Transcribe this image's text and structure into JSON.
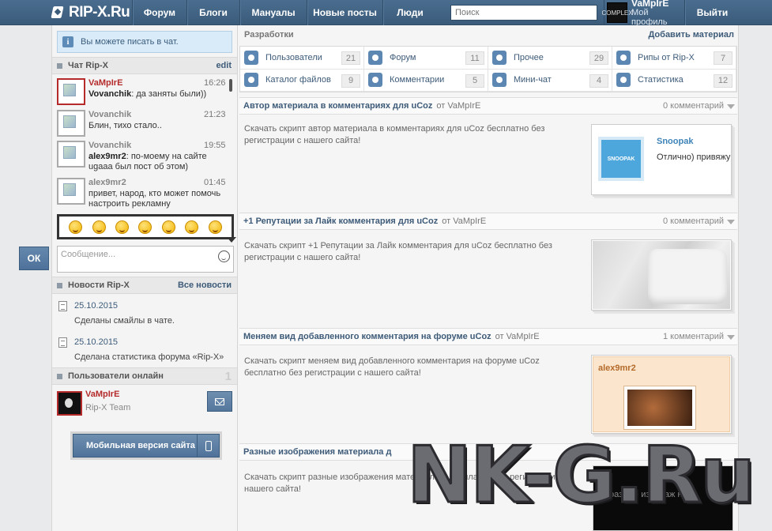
{
  "header": {
    "logo": "RIP-X.Ru",
    "nav": [
      "Форум",
      "Блоги",
      "Мануалы",
      "Новые посты",
      "Люди"
    ],
    "search_placeholder": "Поиск",
    "profile_name": "VaMpIrE",
    "profile_sub": "Мой профиль",
    "logout": "Выйти",
    "avatar_text": "COMPLEX"
  },
  "sidebar": {
    "notice": "Вы можете писать в чат.",
    "chat_title": "Чат Rip-X",
    "chat_edit": "edit",
    "chat": [
      {
        "name": "VaMpIrE",
        "time": "16:26",
        "author": "Vovanchik",
        "text": ": да заняты были))",
        "red": true
      },
      {
        "name": "Vovanchik",
        "time": "21:23",
        "author": "",
        "text": "Блин, тихо стало..",
        "red": false
      },
      {
        "name": "Vovanchik",
        "time": "19:55",
        "author": "alex9mr2",
        "text": ": по-моему на сайте ugaaa был пост об этом)",
        "red": false
      },
      {
        "name": "alex9mr2",
        "time": "01:45",
        "author": "",
        "text": "привет, народ, кто может помочь настроить рекламну",
        "red": false
      }
    ],
    "smiles": [
      "smile-1",
      "smile-2",
      "smile-3",
      "smile-4",
      "smile-5",
      "smile-6",
      "smile-7"
    ],
    "ok_label": "ОК",
    "msg_placeholder": "Сообщение...",
    "news_title": "Новости Rip-X",
    "news_all": "Все новости",
    "news": [
      {
        "date": "25.10.2015",
        "text": "Сделаны смайлы в чате."
      },
      {
        "date": "25.10.2015",
        "text": "Сделана статистика форума «Rip-X»"
      }
    ],
    "online_title": "Пользователи онлайн",
    "online_count": "1",
    "online_user": {
      "name": "VaMpIrE",
      "role": "Rip-X Team"
    },
    "mobile_label": "Мобильная версия сайта"
  },
  "main": {
    "title": "Разработки",
    "add": "Добавить материал",
    "categories": [
      {
        "label": "Пользователи",
        "count": "21",
        "icon": "users-icon"
      },
      {
        "label": "Форум",
        "count": "11",
        "icon": "forum-icon"
      },
      {
        "label": "Прочее",
        "count": "29",
        "icon": "misc-icon"
      },
      {
        "label": "Рипы от Rip-X",
        "count": "7",
        "icon": "gear-icon"
      },
      {
        "label": "Каталог файлов",
        "count": "9",
        "icon": "floppy-icon"
      },
      {
        "label": "Комментарии",
        "count": "5",
        "icon": "comments-icon"
      },
      {
        "label": "Мини-чат",
        "count": "4",
        "icon": "chat-icon"
      },
      {
        "label": "Статистика",
        "count": "12",
        "icon": "stats-icon"
      }
    ],
    "posts": [
      {
        "title": "Автор материала в комментариях для uCoz",
        "by": "от VaMpIrE",
        "comments": "0 комментарий",
        "body": "Скачать скрипт автор материала в комментариях для uCoz бесплатно без регистрации с нашего сайта!"
      },
      {
        "title": "+1 Репутации за Лайк комментария для uCoz",
        "by": "от VaMpIrE",
        "comments": "0 комментарий",
        "body": "Скачать скрипт +1 Репутации за Лайк комментария для uCoz бесплатно без регистрации с нашего сайта!"
      },
      {
        "title": "Меняем вид добавленного комментария на форуме uCoz",
        "by": "от VaMpIrE",
        "comments": "1 комментарий",
        "body": "Скачать скрипт меняем вид добавленного комментария на форуме uCoz бесплатно без регистрации с нашего сайта!"
      },
      {
        "title": "Разные изображения материала д",
        "by": "",
        "comments": "",
        "body": "Скачать скрипт разные изображения материала д бесплатно без регистрации с нашего сайта!"
      }
    ],
    "snoopak": {
      "logo": "SNOOPAK",
      "name": "Snoopak",
      "text": "Отлично) привяжу"
    },
    "alex": "alex9mr2",
    "dark_text": "разные изображ ния"
  },
  "watermark": "NK-G.Ru"
}
